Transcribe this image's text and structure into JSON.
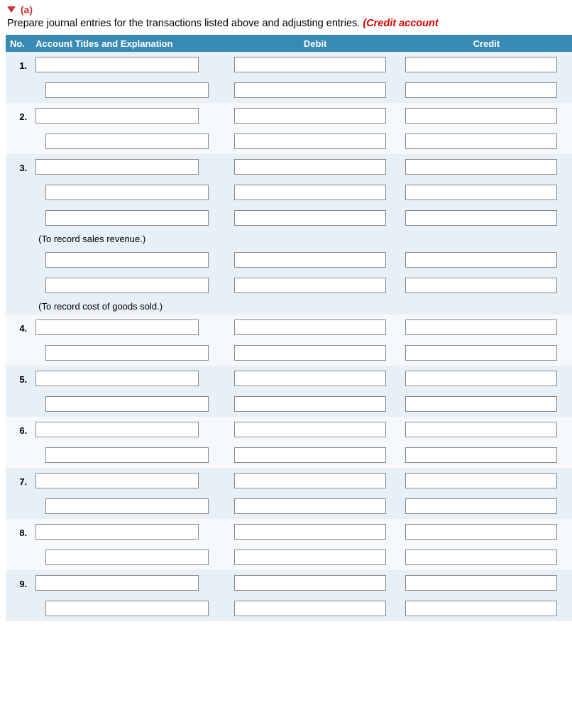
{
  "section": {
    "label": "(a)"
  },
  "instruction": {
    "text": "Prepare journal entries for the transactions listed above and adjusting entries. ",
    "emph": "(Credit account"
  },
  "headers": {
    "no": "No.",
    "account": "Account Titles and Explanation",
    "debit": "Debit",
    "credit": "Credit"
  },
  "notes": {
    "sales_rev": "(To record sales revenue.)",
    "cogs": "(To record cost of goods sold.)"
  },
  "entries": {
    "e1": {
      "no": "1."
    },
    "e2": {
      "no": "2."
    },
    "e3": {
      "no": "3."
    },
    "e4": {
      "no": "4."
    },
    "e5": {
      "no": "5."
    },
    "e6": {
      "no": "6."
    },
    "e7": {
      "no": "7."
    },
    "e8": {
      "no": "8."
    },
    "e9": {
      "no": "9."
    }
  }
}
